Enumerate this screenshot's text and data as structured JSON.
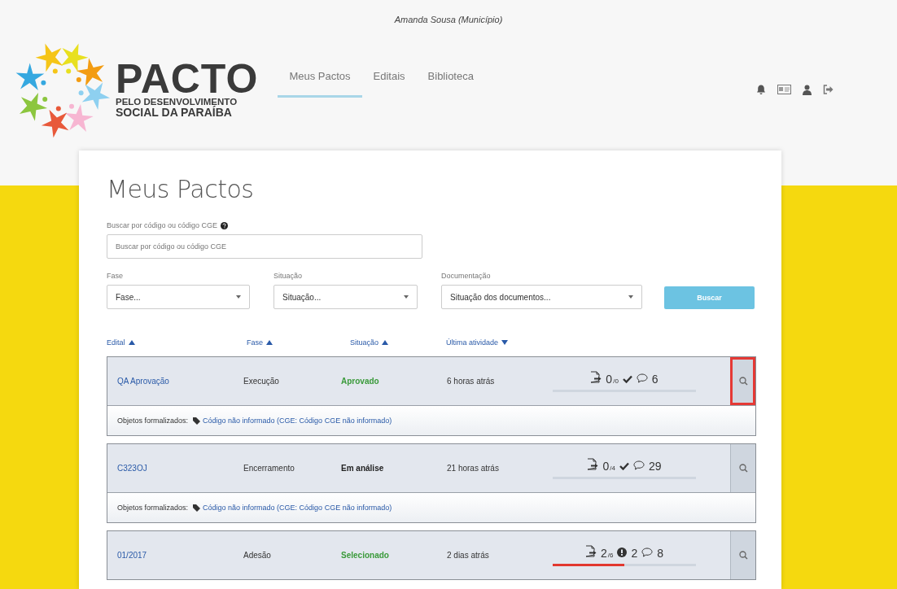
{
  "header": {
    "user": "Amanda Sousa (Município)",
    "logo": {
      "title": "PACTO",
      "subtitle_1": "PELO DESENVOLVIMENTO",
      "subtitle_2": "SOCIAL DA PARAÍBA"
    },
    "nav": [
      {
        "label": "Meus Pactos",
        "selected": true
      },
      {
        "label": "Editais",
        "selected": false
      },
      {
        "label": "Biblioteca",
        "selected": false
      }
    ]
  },
  "page": {
    "title": "Meus Pactos",
    "search": {
      "label": "Buscar por código ou código CGE",
      "placeholder": "Buscar por código ou código CGE"
    },
    "filters": [
      {
        "label": "Fase",
        "value": "Fase..."
      },
      {
        "label": "Situação",
        "value": "Situação..."
      },
      {
        "label": "Documentação",
        "value": "Situação dos documentos..."
      }
    ],
    "search_button": "Buscar",
    "sort_columns": [
      {
        "label": "Edital",
        "kind": "up"
      },
      {
        "label": "Fase",
        "kind": "up"
      },
      {
        "label": "Situação",
        "kind": "up"
      },
      {
        "label": "Última atividade",
        "kind": "down"
      }
    ],
    "rows": [
      {
        "edital": "QA Aprovação",
        "fase": "Execução",
        "situacao": "Aprovado",
        "color": "#3a9a3a",
        "atividade": "6 horas atrás",
        "docs": "0",
        "docs_total": "/0",
        "kind": "check",
        "comments": "6",
        "level": 0,
        "highlighted": true,
        "objetos_label": "Objetos formalizados:",
        "objetos_link": "Código não informado (CGE: Código CGE não informado)"
      },
      {
        "edital": "C323OJ",
        "fase": "Encerramento",
        "situacao": "Em análise",
        "color": "#222222",
        "atividade": "21 horas atrás",
        "docs": "0",
        "docs_total": "/4",
        "kind": "check",
        "comments": "29",
        "level": 0,
        "highlighted": false,
        "objetos_label": "Objetos formalizados:",
        "objetos_link": "Código não informado (CGE: Código CGE não informado)"
      },
      {
        "edital": "01/2017",
        "fase": "Adesão",
        "situacao": "Selecionado",
        "color": "#3a9a3a",
        "atividade": "2 dias atrás",
        "docs": "2",
        "docs_total": "/6",
        "kind": "alert",
        "alert_count": "2",
        "comments": "8",
        "level": 0.5,
        "highlighted": false
      }
    ]
  }
}
